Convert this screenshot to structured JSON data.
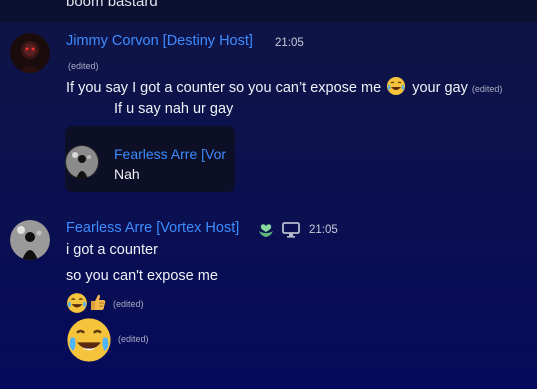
{
  "previous_message": {
    "text": "boom bastard"
  },
  "message_1": {
    "author": "Jimmy Corvon [Destiny Host]",
    "timestamp": "21:05",
    "edited_label_top": "(edited)",
    "text_before_emoji": "If you say I got a counter so you can’t expose me",
    "emoji": "joy-emoji",
    "text_after_emoji": "your gay",
    "edited_label_inline": "(edited)",
    "embed": {
      "top_text": "If u say nah ur gay",
      "author": "Fearless Arre [Vor",
      "text": "Nah"
    }
  },
  "message_2": {
    "author": "Fearless Arre [Vortex Host]",
    "badges": [
      "heart-hands-icon",
      "desktop-icon"
    ],
    "timestamp": "21:05",
    "lines": [
      "i got a counter",
      "so you can't expose me"
    ],
    "emoji_row": [
      "joy-emoji",
      "thumbs-up-emoji"
    ],
    "edited_label_1": "(edited)",
    "big_emoji": "joy-emoji",
    "edited_label_2": "(edited)"
  },
  "colors": {
    "author_name": "#3e8cff",
    "background_top": "#0f1545",
    "background_bottom": "#050a5c",
    "text": "#f0f2f8"
  }
}
